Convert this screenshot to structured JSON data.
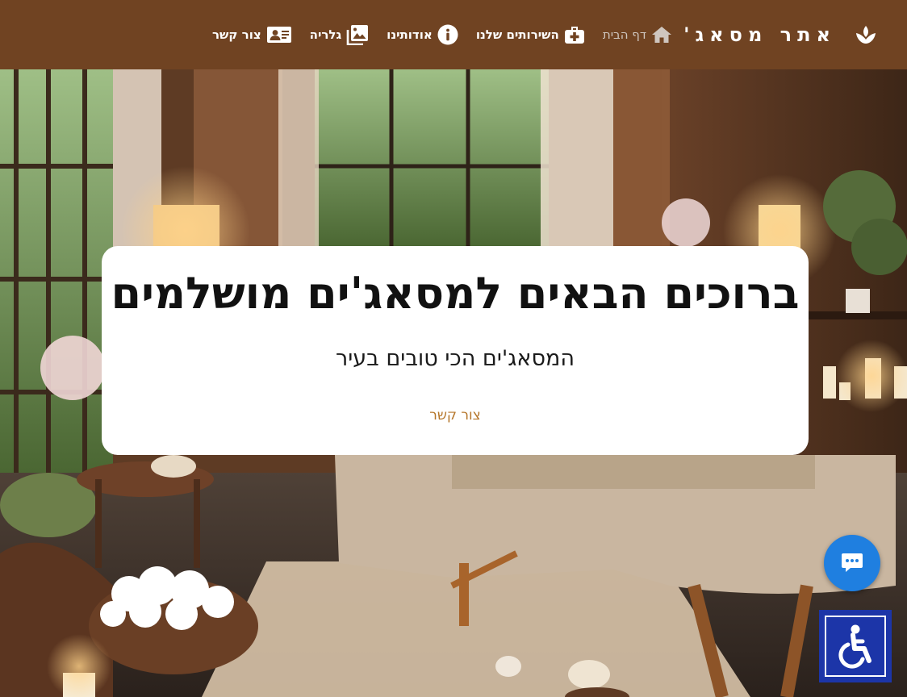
{
  "navbar": {
    "brand_title": "אתר מסאג'",
    "logo_icon": "lotus-icon",
    "items": [
      {
        "label": "דף הבית",
        "icon": "home-icon",
        "active": true
      },
      {
        "label": "השירותים שלנו",
        "icon": "medical-kit-icon",
        "active": false
      },
      {
        "label": "אודותינו",
        "icon": "info-icon",
        "active": false
      },
      {
        "label": "גלריה",
        "icon": "gallery-icon",
        "active": false
      },
      {
        "label": "צור קשר",
        "icon": "contact-card-icon",
        "active": false
      }
    ]
  },
  "hero": {
    "title": "ברוכים הבאים למסאג'ים מושלמים",
    "subtitle": "המסאג'ים הכי טובים בעיר",
    "cta_label": "צור קשר"
  },
  "floating": {
    "chat_icon": "chat-bubble-icon",
    "accessibility_icon": "wheelchair-icon"
  },
  "colors": {
    "navbar_bg": "#704322",
    "nav_active_text": "#cfc6bf",
    "cta_link": "#b5762a",
    "chat_button": "#1f7fe0",
    "accessibility_button": "#1c35a8"
  }
}
